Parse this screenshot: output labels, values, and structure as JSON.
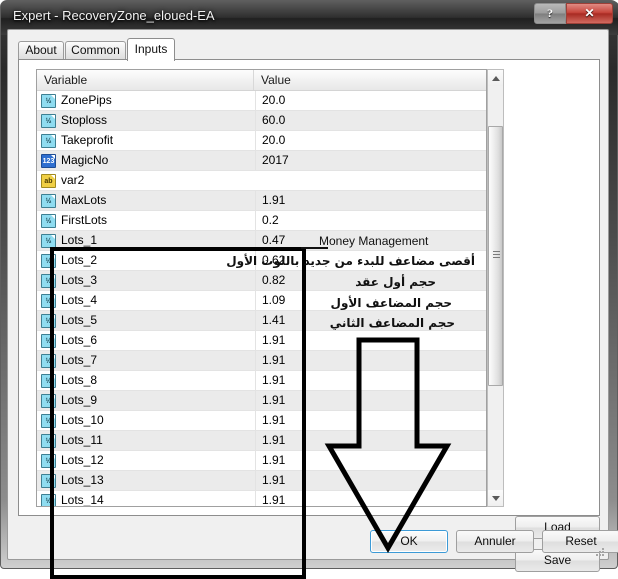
{
  "window": {
    "title": "Expert - RecoveryZone_eloued-EA",
    "help_button": "?",
    "close_button": "✕"
  },
  "tabs": [
    {
      "label": "About",
      "active": false
    },
    {
      "label": "Common",
      "active": false
    },
    {
      "label": "Inputs",
      "active": true
    }
  ],
  "table": {
    "columns": [
      "Variable",
      "Value"
    ],
    "rows": [
      {
        "icon": "double-variable-icon",
        "icon_text": "½",
        "icon_type": "dbl",
        "variable": "ZonePips",
        "value": "20.0"
      },
      {
        "icon": "double-variable-icon",
        "icon_text": "½",
        "icon_type": "dbl",
        "variable": "Stoploss",
        "value": "60.0"
      },
      {
        "icon": "double-variable-icon",
        "icon_text": "½",
        "icon_type": "dbl",
        "variable": "Takeprofit",
        "value": "20.0"
      },
      {
        "icon": "integer-variable-icon",
        "icon_text": "123",
        "icon_type": "int",
        "variable": "MagicNo",
        "value": "2017"
      },
      {
        "icon": "string-variable-icon",
        "icon_text": "ab",
        "icon_type": "str",
        "variable": "var2",
        "value": ""
      },
      {
        "icon": "double-variable-icon",
        "icon_text": "½",
        "icon_type": "dbl",
        "variable": "MaxLots",
        "value": "1.91"
      },
      {
        "icon": "double-variable-icon",
        "icon_text": "½",
        "icon_type": "dbl",
        "variable": "FirstLots",
        "value": "0.2"
      },
      {
        "icon": "double-variable-icon",
        "icon_text": "½",
        "icon_type": "dbl",
        "variable": "Lots_1",
        "value": "0.47"
      },
      {
        "icon": "double-variable-icon",
        "icon_text": "½",
        "icon_type": "dbl",
        "variable": "Lots_2",
        "value": "0.62"
      },
      {
        "icon": "double-variable-icon",
        "icon_text": "½",
        "icon_type": "dbl",
        "variable": "Lots_3",
        "value": "0.82"
      },
      {
        "icon": "double-variable-icon",
        "icon_text": "½",
        "icon_type": "dbl",
        "variable": "Lots_4",
        "value": "1.09"
      },
      {
        "icon": "double-variable-icon",
        "icon_text": "½",
        "icon_type": "dbl",
        "variable": "Lots_5",
        "value": "1.41"
      },
      {
        "icon": "double-variable-icon",
        "icon_text": "½",
        "icon_type": "dbl",
        "variable": "Lots_6",
        "value": "1.91"
      },
      {
        "icon": "double-variable-icon",
        "icon_text": "½",
        "icon_type": "dbl",
        "variable": "Lots_7",
        "value": "1.91"
      },
      {
        "icon": "double-variable-icon",
        "icon_text": "½",
        "icon_type": "dbl",
        "variable": "Lots_8",
        "value": "1.91"
      },
      {
        "icon": "double-variable-icon",
        "icon_text": "½",
        "icon_type": "dbl",
        "variable": "Lots_9",
        "value": "1.91"
      },
      {
        "icon": "double-variable-icon",
        "icon_text": "½",
        "icon_type": "dbl",
        "variable": "Lots_10",
        "value": "1.91"
      },
      {
        "icon": "double-variable-icon",
        "icon_text": "½",
        "icon_type": "dbl",
        "variable": "Lots_11",
        "value": "1.91"
      },
      {
        "icon": "double-variable-icon",
        "icon_text": "½",
        "icon_type": "dbl",
        "variable": "Lots_12",
        "value": "1.91"
      },
      {
        "icon": "double-variable-icon",
        "icon_text": "½",
        "icon_type": "dbl",
        "variable": "Lots_13",
        "value": "1.91"
      },
      {
        "icon": "double-variable-icon",
        "icon_text": "½",
        "icon_type": "dbl",
        "variable": "Lots_14",
        "value": "1.91"
      }
    ]
  },
  "annotations": {
    "money_management": "Money Management",
    "arabic_1": "أقصى مضاعف للبدء من جديد باللوت الأول",
    "arabic_2": "حجم أول عقد",
    "arabic_3": "حجم المضاعف الأول",
    "arabic_4": "حجم المضاعف الثاني",
    "arrow": "down-arrow-annotation",
    "highlight": "highlight-rectangle"
  },
  "side_buttons": {
    "load": "Load",
    "save": "Save"
  },
  "bottom_buttons": {
    "ok": "OK",
    "cancel": "Annuler",
    "reset": "Reset"
  },
  "colors": {
    "accent": "#3c9ad6",
    "close_button": "#c7453c",
    "annotation": "#111111",
    "row_alt": "#ebebeb"
  }
}
